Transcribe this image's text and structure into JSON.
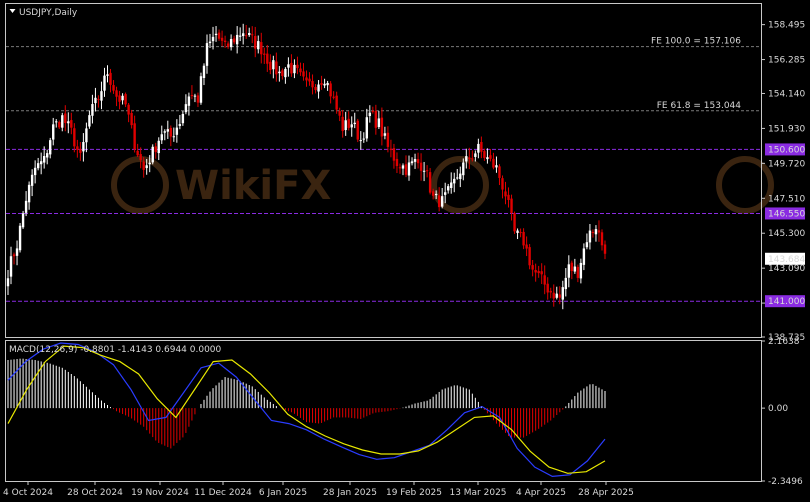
{
  "window": {
    "symbol_title": "USDJPY,Daily",
    "menu_icon": "triangle-down-icon"
  },
  "colors": {
    "background": "#000000",
    "frame": "#c8c8c8",
    "text": "#d8d8d8",
    "bull_candle": "#ffffff",
    "bear_candle": "#e00000",
    "level_line": "#8a2be2",
    "fib_line": "#7a7a7a",
    "macd_hist_pos": "#ffffff",
    "macd_hist_neg": "#e00000",
    "macd_line": "#2a3cff",
    "signal_line": "#e8e800",
    "watermark": "#3a2410"
  },
  "watermark": {
    "text": "WikiFX",
    "icon": "wikifx-logo-icon"
  },
  "main_axis": {
    "ticks": [
      "158.495",
      "156.285",
      "154.140",
      "151.930",
      "149.720",
      "147.510",
      "145.300",
      "143.090",
      "140.880",
      "138.735"
    ],
    "current_price": "143.684"
  },
  "levels": [
    {
      "value": 150.6,
      "label": "150.600"
    },
    {
      "value": 146.55,
      "label": "146.550"
    },
    {
      "value": 141.0,
      "label": "141.000"
    }
  ],
  "fib_levels": [
    {
      "value": 157.106,
      "label": "FE 100.0 = 157.106"
    },
    {
      "value": 153.044,
      "label": "FE 61.8 = 153.044"
    }
  ],
  "macd_panel": {
    "label": "MACD(12,26,9) -0.8801 -1.4143 0.6944 0.0000",
    "ticks": [
      "2.1638",
      "0.00",
      "-2.3496"
    ]
  },
  "x_axis": {
    "labels": [
      "4 Oct 2024",
      "28 Oct 2024",
      "19 Nov 2024",
      "11 Dec 2024",
      "6 Jan 2025",
      "28 Jan 2025",
      "19 Feb 2025",
      "13 Mar 2025",
      "4 Apr 2025",
      "28 Apr 2025"
    ]
  },
  "chart_data": {
    "type": "candlestick",
    "symbol": "USDJPY",
    "timeframe": "Daily",
    "ylim": [
      138.735,
      159.8
    ],
    "anchor_closes": [
      142.9,
      144.6,
      147.5,
      149.4,
      149.9,
      152.0,
      152.6,
      151.7,
      150.0,
      152.7,
      153.9,
      155.5,
      154.0,
      153.4,
      151.0,
      149.3,
      150.4,
      151.7,
      151.4,
      152.4,
      154.1,
      153.8,
      157.0,
      157.9,
      157.0,
      157.6,
      158.1,
      157.5,
      157.0,
      156.0,
      155.4,
      155.9,
      155.4,
      154.6,
      154.8,
      155.2,
      153.7,
      152.0,
      152.3,
      151.2,
      152.8,
      152.2,
      150.7,
      149.8,
      149.4,
      149.8,
      149.6,
      147.5,
      147.3,
      148.1,
      149.3,
      150.1,
      150.6,
      150.0,
      149.4,
      147.8,
      145.3,
      144.8,
      143.0,
      142.3,
      141.6,
      141.2,
      143.1,
      142.9,
      145.0,
      145.8,
      144.0
    ],
    "macd": {
      "histogram": [
        1.55,
        1.6,
        1.55,
        1.45,
        1.3,
        1.0,
        0.6,
        0.2,
        -0.1,
        -0.3,
        -0.6,
        -1.1,
        -1.3,
        -0.9,
        0.0,
        0.6,
        1.0,
        0.9,
        0.7,
        0.3,
        0.0,
        -0.15,
        -0.45,
        -0.5,
        -0.3,
        -0.3,
        -0.35,
        -0.15,
        -0.1,
        0.0,
        0.15,
        0.25,
        0.6,
        0.75,
        0.6,
        0.0,
        -0.5,
        -0.95,
        -0.95,
        -0.7,
        -0.4,
        0.0,
        0.5,
        0.8,
        0.55
      ],
      "macd_line": [
        0.9,
        1.5,
        1.9,
        2.1,
        2.05,
        1.8,
        1.4,
        0.6,
        -0.4,
        -0.3,
        0.5,
        1.3,
        1.45,
        1.0,
        0.3,
        -0.4,
        -0.5,
        -0.7,
        -1.0,
        -1.25,
        -1.5,
        -1.65,
        -1.6,
        -1.4,
        -1.2,
        -0.7,
        -0.15,
        0.05,
        -0.3,
        -1.3,
        -1.9,
        -2.2,
        -2.15,
        -1.7,
        -1.0
      ],
      "signal_line": [
        -0.5,
        0.6,
        1.5,
        2.0,
        1.95,
        1.7,
        1.5,
        1.1,
        0.3,
        -0.3,
        0.6,
        1.5,
        1.55,
        1.1,
        0.5,
        -0.2,
        -0.6,
        -0.9,
        -1.15,
        -1.35,
        -1.48,
        -1.48,
        -1.38,
        -1.1,
        -0.7,
        -0.3,
        -0.25,
        -0.7,
        -1.4,
        -1.9,
        -2.1,
        -2.05,
        -1.7
      ]
    }
  }
}
